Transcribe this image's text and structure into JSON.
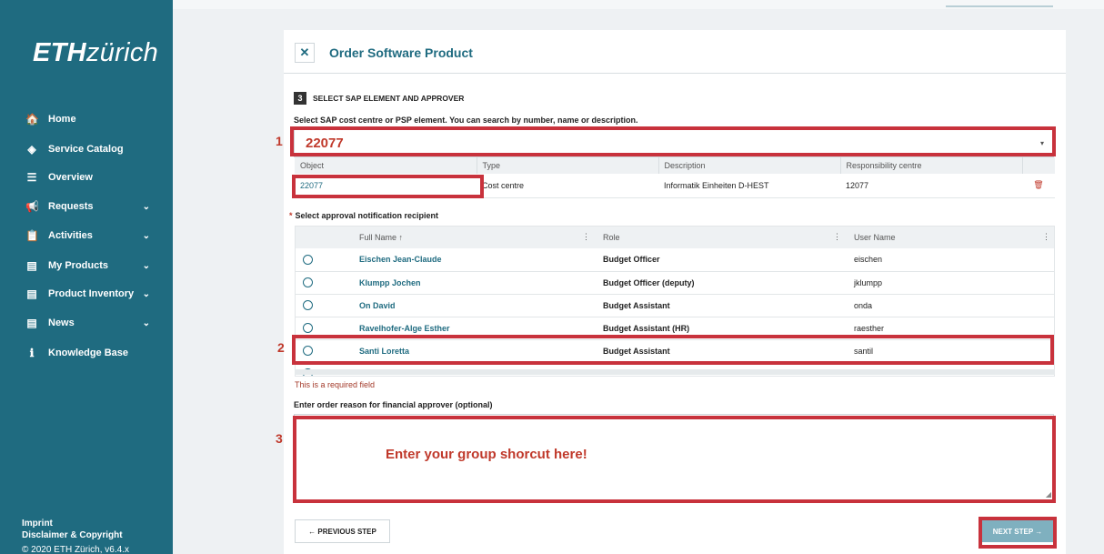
{
  "sidebar": {
    "logo_bold": "ETH",
    "logo_italic": "zürich",
    "items": [
      {
        "label": "Home",
        "icon": "home-icon",
        "glyph": "🏠"
      },
      {
        "label": "Service Catalog",
        "icon": "layers-icon",
        "glyph": "◈"
      },
      {
        "label": "Overview",
        "icon": "list-icon",
        "glyph": "☰"
      },
      {
        "label": "Requests",
        "icon": "megaphone-icon",
        "glyph": "📢",
        "chevron": "⌄"
      },
      {
        "label": "Activities",
        "icon": "clipboard-icon",
        "glyph": "📋",
        "chevron": "⌄"
      },
      {
        "label": "My Products",
        "icon": "document-icon",
        "glyph": "▤",
        "chevron": "⌄"
      },
      {
        "label": "Product Inventory",
        "icon": "document-icon",
        "glyph": "▤",
        "chevron": "⌄"
      },
      {
        "label": "News",
        "icon": "document-icon",
        "glyph": "▤",
        "chevron": "⌄"
      },
      {
        "label": "Knowledge Base",
        "icon": "info-icon",
        "glyph": "ℹ"
      }
    ],
    "footer": {
      "imprint": "Imprint",
      "disclaimer": "Disclaimer & Copyright",
      "copyright": "© 2020 ETH Zürich, v6.4.x"
    }
  },
  "card": {
    "close_glyph": "✕",
    "title": "Order Software Product",
    "step_number": "3",
    "step_title": "SELECT SAP ELEMENT AND APPROVER",
    "cc_label": "Select SAP cost centre or PSP element. You can search by number, name or description.",
    "cc_value": "22077",
    "caret": "▾",
    "object_table": {
      "headers": [
        "Object",
        "Type",
        "Description",
        "Responsibility centre"
      ],
      "row": {
        "object": "22077",
        "type": "Cost centre",
        "description": "Informatik Einheiten D-HEST",
        "responsibility": "12077",
        "delete_glyph": "🗑"
      }
    },
    "approver_label_star": "*",
    "approver_label": "Select approval notification recipient",
    "approver_table": {
      "headers": [
        "Full Name ↑",
        "Role",
        "User Name"
      ],
      "kebab": "⋮",
      "rows": [
        {
          "name": "Eischen Jean-Claude",
          "role": "Budget Officer",
          "user": "eischen"
        },
        {
          "name": "Klumpp Jochen",
          "role": "Budget Officer (deputy)",
          "user": "jklumpp"
        },
        {
          "name": "On David",
          "role": "Budget Assistant",
          "user": "onda"
        },
        {
          "name": "Ravelhofer-Alge Esther",
          "role": "Budget Assistant (HR)",
          "user": "raesther"
        },
        {
          "name": "Santi Loretta",
          "role": "Budget Assistant",
          "user": "santil"
        }
      ]
    },
    "required_msg": "This is a required field",
    "reason_label": "Enter order reason for financial approver (optional)",
    "reason_placeholder": "Enter your group shorcut here!",
    "resize_glyph": "◢",
    "prev_label": "← PREVIOUS STEP",
    "next_label": "NEXT STEP →"
  },
  "annotations": {
    "one": "1",
    "two": "2",
    "three": "3",
    "color": "#c8323c"
  }
}
